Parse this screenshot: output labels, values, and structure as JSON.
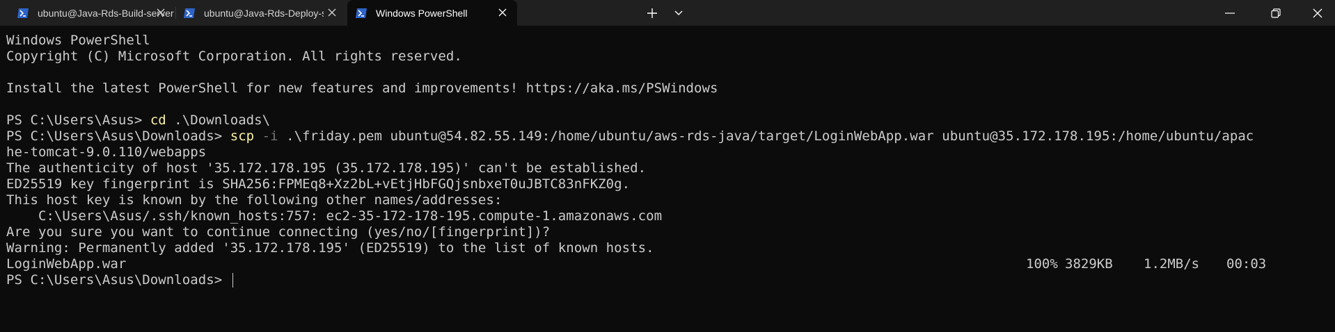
{
  "tabs": [
    {
      "label": "ubuntu@Java-Rds-Build-server",
      "active": false,
      "icon": "powershell-icon"
    },
    {
      "label": "ubuntu@Java-Rds-Deploy-server",
      "active": false,
      "icon": "powershell-icon"
    },
    {
      "label": "Windows PowerShell",
      "active": true,
      "icon": "powershell-icon"
    }
  ],
  "colors": {
    "background": "#0c0c0c",
    "titlebar": "#202020",
    "text": "#cccccc",
    "command": "#f9f1a5",
    "parameter": "#767676",
    "icon_blue": "#2d63c8"
  },
  "terminal": {
    "lines": [
      "Windows PowerShell",
      "Copyright (C) Microsoft Corporation. All rights reserved.",
      "",
      "Install the latest PowerShell for new features and improvements! https://aka.ms/PSWindows",
      "",
      "PS C:\\Users\\Asus> ",
      "PS C:\\Users\\Asus\\Downloads> ",
      "he-tomcat-9.0.110/webapps",
      "The authenticity of host '35.172.178.195 (35.172.178.195)' can't be established.",
      "ED25519 key fingerprint is SHA256:FPMEq8+Xz2bL+vEtjHbFGQjsnbxeT0uJBTC83nFKZ0g.",
      "This host key is known by the following other names/addresses:",
      "    C:\\Users\\Asus/.ssh/known_hosts:757: ec2-35-172-178-195.compute-1.amazonaws.com",
      "Are you sure you want to continue connecting (yes/no/[fingerprint])?",
      "Warning: Permanently added '35.172.178.195' (ED25519) to the list of known hosts.",
      "LoginWebApp.war",
      "PS C:\\Users\\Asus\\Downloads> "
    ],
    "cmd1": {
      "command": "cd",
      "args": " .\\Downloads\\"
    },
    "cmd2": {
      "command": "scp",
      "flag": " -i",
      "args": " .\\friday.pem ubuntu@54.82.55.149:/home/ubuntu/aws-rds-java/target/LoginWebApp.war ubuntu@35.172.178.195:/home/ubuntu/apac"
    },
    "transfer": {
      "percent": "100%",
      "size": "3829KB",
      "speed": "1.2MB/s",
      "eta": "00:03"
    }
  }
}
